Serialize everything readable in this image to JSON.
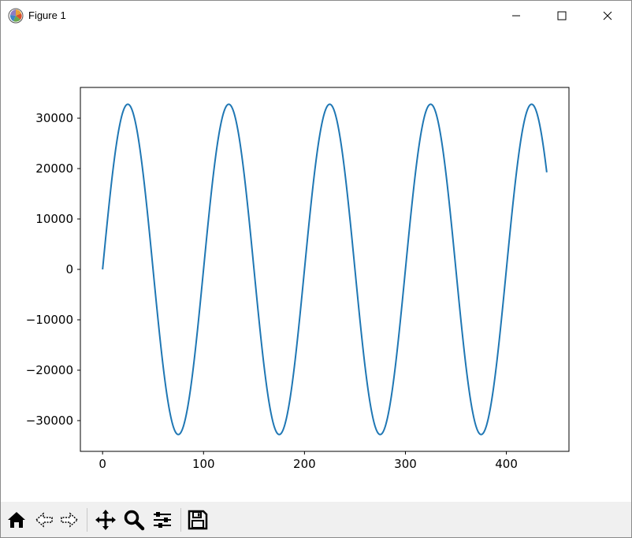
{
  "window": {
    "title": "Figure 1"
  },
  "toolbar": {
    "buttons": [
      {
        "icon": "home-icon"
      },
      {
        "icon": "back-icon"
      },
      {
        "icon": "forward-icon"
      },
      {
        "icon": "pan-icon"
      },
      {
        "icon": "zoom-icon"
      },
      {
        "icon": "configure-subplots-icon"
      },
      {
        "icon": "save-icon"
      }
    ]
  },
  "colors": {
    "line": "#1f77b4",
    "toolbar_bg": "#f0f0f0"
  },
  "chart_data": {
    "type": "line",
    "title": "",
    "xlabel": "",
    "ylabel": "",
    "xlim": [
      -22,
      462
    ],
    "ylim": [
      -36100,
      36100
    ],
    "xticks": [
      0,
      100,
      200,
      300,
      400
    ],
    "xtick_labels": [
      "0",
      "100",
      "200",
      "300",
      "400"
    ],
    "yticks": [
      30000,
      20000,
      10000,
      0,
      -10000,
      -20000,
      -30000
    ],
    "ytick_labels": [
      "30000",
      "20000",
      "10000",
      "0",
      "−10000",
      "−20000",
      "−30000"
    ],
    "series": [
      {
        "amplitude": 32767,
        "period": 100,
        "x_start": 0,
        "x_end": 440,
        "x": [
          0,
          25,
          50,
          75,
          100,
          125,
          150,
          175,
          200,
          225,
          250,
          275,
          300,
          325,
          350,
          375,
          400,
          425,
          440
        ],
        "y": [
          0,
          32767,
          0,
          -32767,
          0,
          32767,
          0,
          -32767,
          0,
          32767,
          0,
          -32767,
          0,
          32767,
          0,
          -32767,
          0,
          32767,
          20900
        ]
      }
    ],
    "grid": false,
    "legend": "none"
  }
}
